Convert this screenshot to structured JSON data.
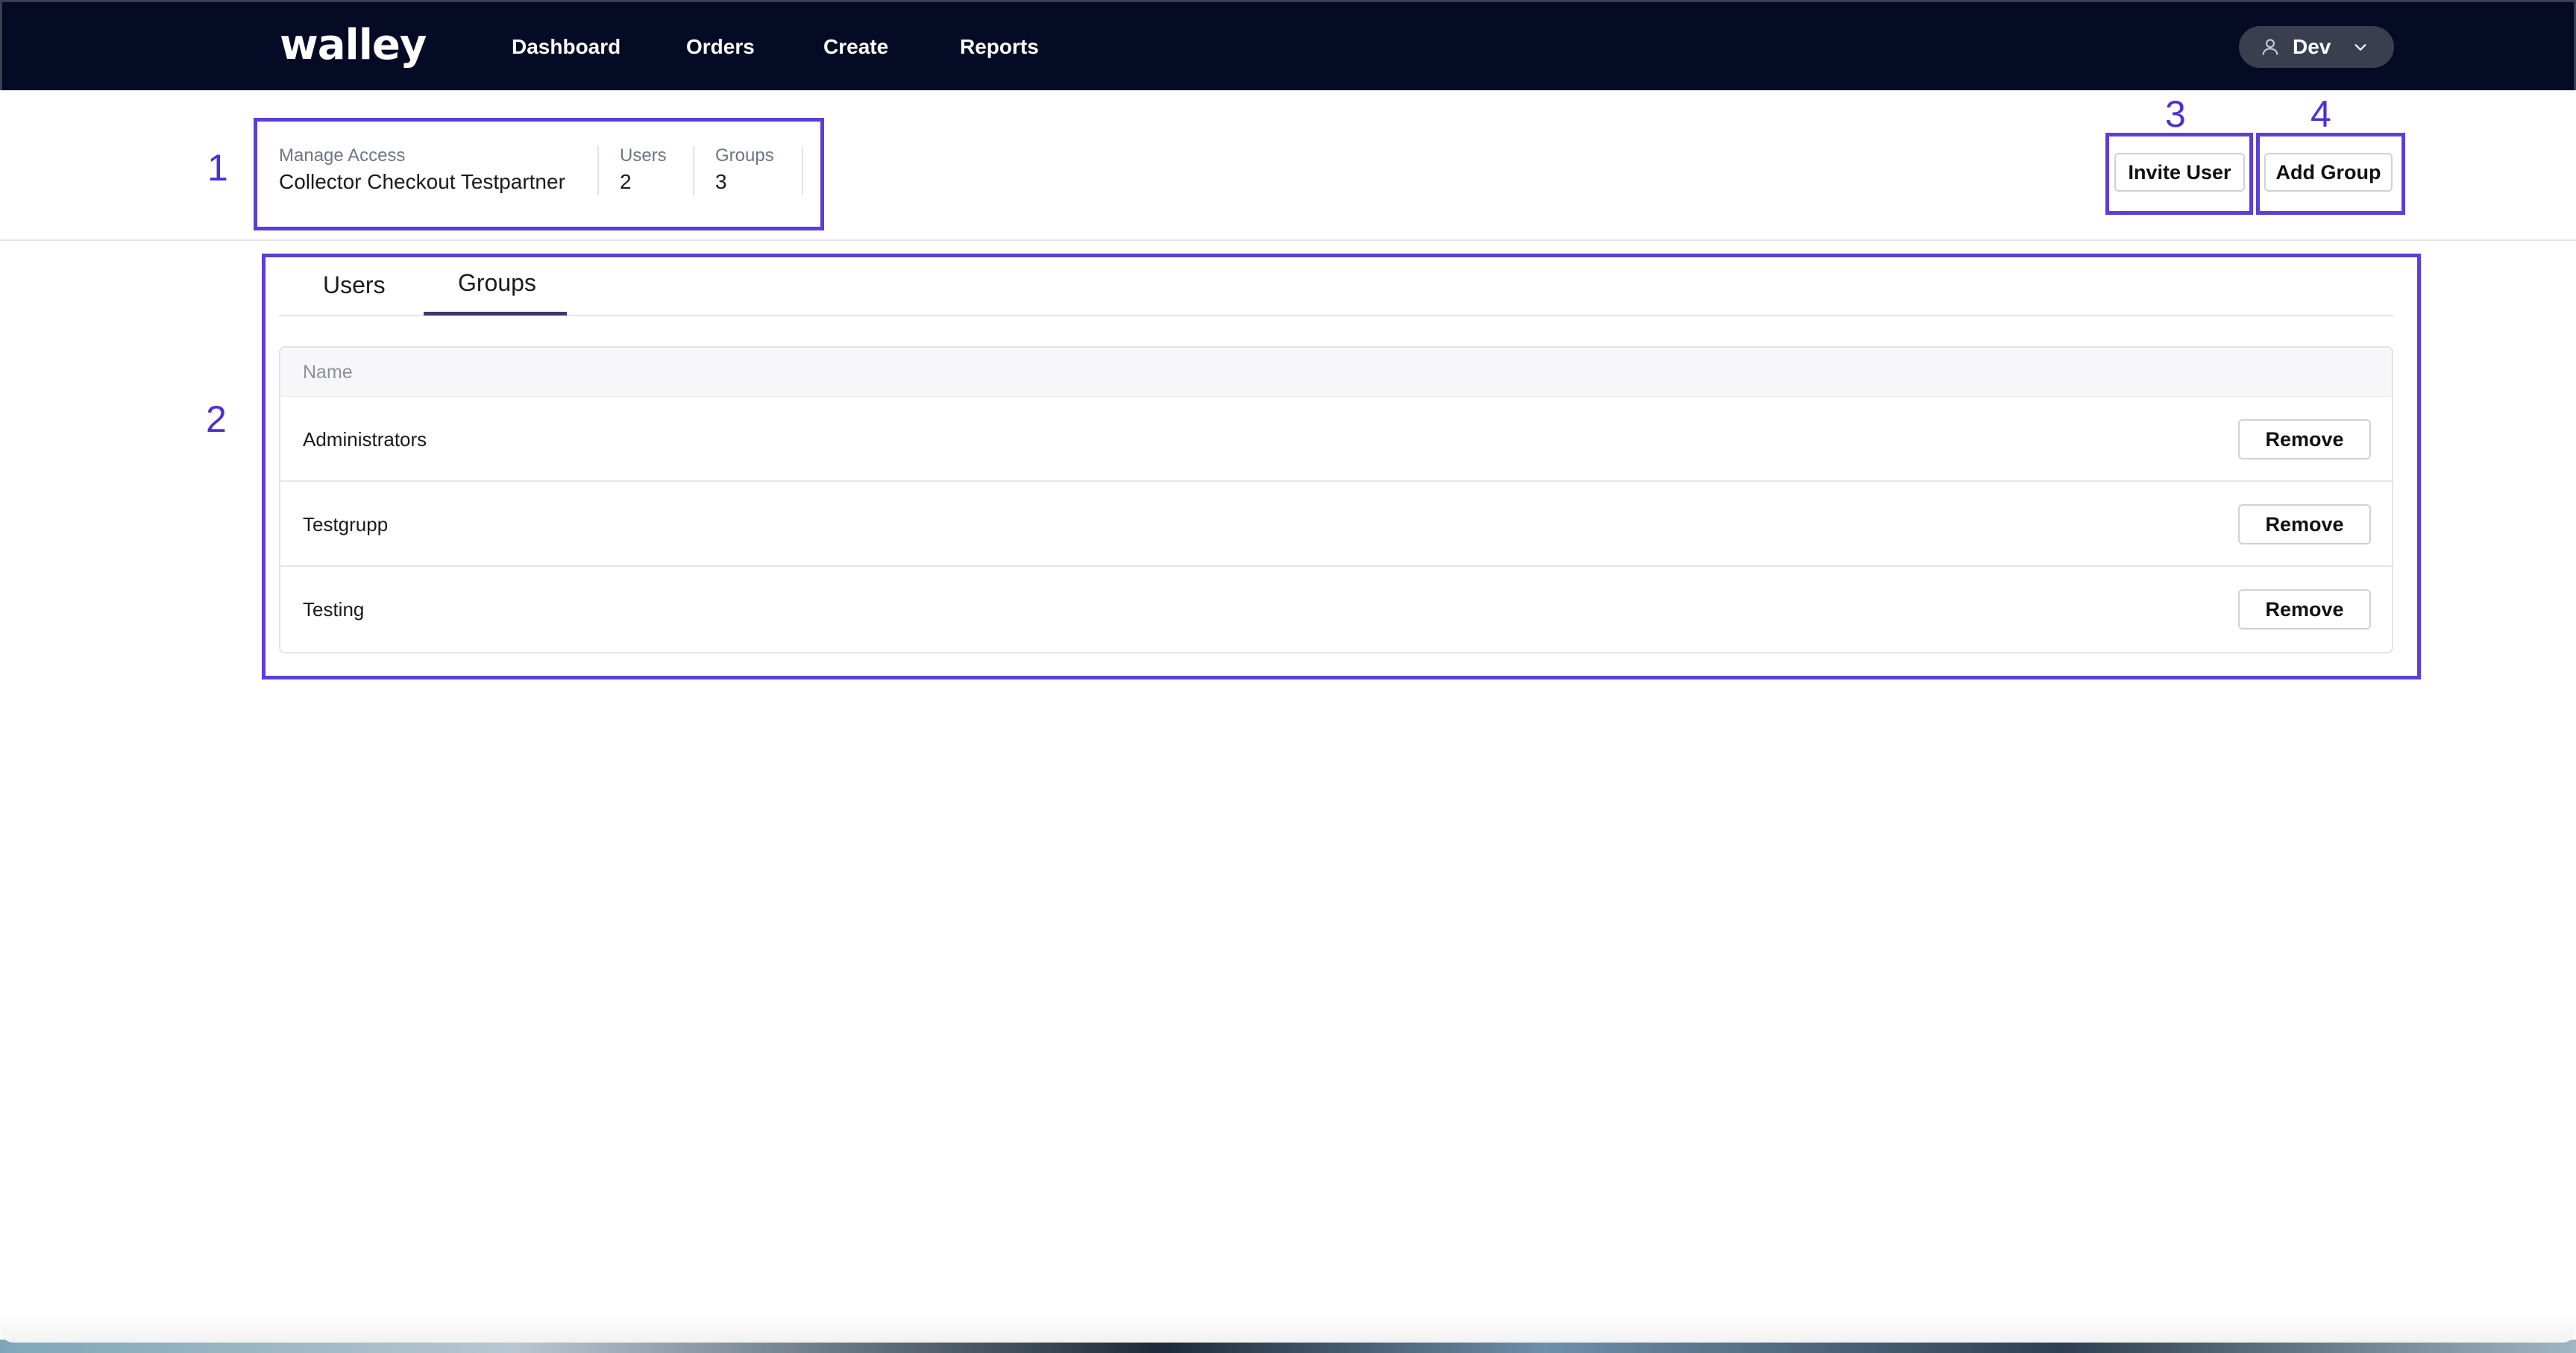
{
  "app": {
    "logo_text": "walley"
  },
  "nav": {
    "items": [
      "Dashboard",
      "Orders",
      "Create",
      "Reports"
    ]
  },
  "user_menu": {
    "label": "Dev",
    "icon": "user-icon",
    "chevron_icon": "chevron-down-icon"
  },
  "annotations": {
    "n1": "1",
    "n2": "2",
    "n3": "3",
    "n4": "4",
    "color": "#5b3fd6"
  },
  "header": {
    "manage_access_label": "Manage Access",
    "partner_name": "Collector Checkout Testpartner",
    "users_label": "Users",
    "users_count": "2",
    "groups_label": "Groups",
    "groups_count": "3"
  },
  "actions": {
    "invite_user": "Invite User",
    "add_group": "Add Group"
  },
  "tabs": {
    "items": [
      "Users",
      "Groups"
    ],
    "active": "Groups"
  },
  "table": {
    "column_name": "Name",
    "rows": [
      {
        "name": "Administrators",
        "action": "Remove"
      },
      {
        "name": "Testgrupp",
        "action": "Remove"
      },
      {
        "name": "Testing",
        "action": "Remove"
      }
    ]
  },
  "colors": {
    "nav_background": "#050b24",
    "accent": "#5b3fd6",
    "tab_active": "#40356e"
  }
}
